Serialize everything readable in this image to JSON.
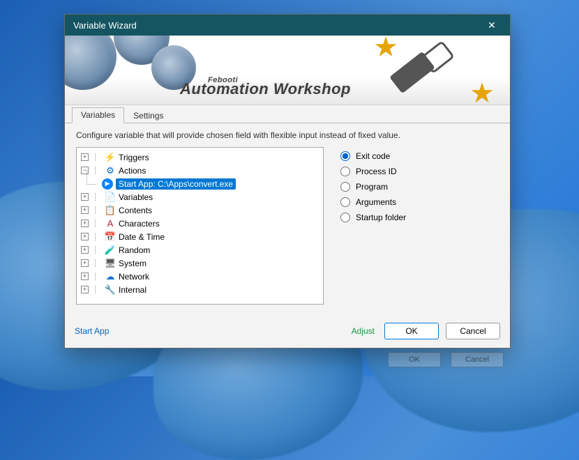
{
  "window": {
    "title": "Variable Wizard"
  },
  "brand": {
    "company": "Febooti",
    "product": "Automation Workshop"
  },
  "tabs": [
    {
      "label": "Variables",
      "active": true
    },
    {
      "label": "Settings",
      "active": false
    }
  ],
  "description": "Configure variable that will provide chosen field with flexible input instead of fixed value.",
  "tree": {
    "nodes": [
      {
        "icon": "⚡",
        "color": "#e5a50a",
        "label": "Triggers",
        "expanded": false
      },
      {
        "icon": "⚙",
        "color": "#0066cc",
        "label": "Actions",
        "expanded": true,
        "children": [
          {
            "icon": "▶",
            "color": "#0a84ff",
            "label": "Start App: C:\\Apps\\convert.exe",
            "selected": true
          }
        ]
      },
      {
        "icon": "📄",
        "color": "#f5c211",
        "label": "Variables",
        "expanded": false
      },
      {
        "icon": "📋",
        "color": "#f5c211",
        "label": "Contents",
        "expanded": false
      },
      {
        "icon": "A",
        "color": "#c01c28",
        "label": "Characters",
        "expanded": false
      },
      {
        "icon": "📅",
        "color": "#c01c28",
        "label": "Date & Time",
        "expanded": false
      },
      {
        "icon": "🧪",
        "color": "#1c71d8",
        "label": "Random",
        "expanded": false
      },
      {
        "icon": "🖥",
        "color": "#555555",
        "label": "System",
        "expanded": false
      },
      {
        "icon": "☁",
        "color": "#1c71d8",
        "label": "Network",
        "expanded": false
      },
      {
        "icon": "🔧",
        "color": "#1c71d8",
        "label": "Internal",
        "expanded": false
      }
    ]
  },
  "options": [
    {
      "label": "Exit code",
      "checked": true
    },
    {
      "label": "Process ID",
      "checked": false
    },
    {
      "label": "Program",
      "checked": false
    },
    {
      "label": "Arguments",
      "checked": false
    },
    {
      "label": "Startup folder",
      "checked": false
    }
  ],
  "footer": {
    "status": "Start App",
    "adjust": "Adjust",
    "ok": "OK",
    "cancel": "Cancel"
  }
}
